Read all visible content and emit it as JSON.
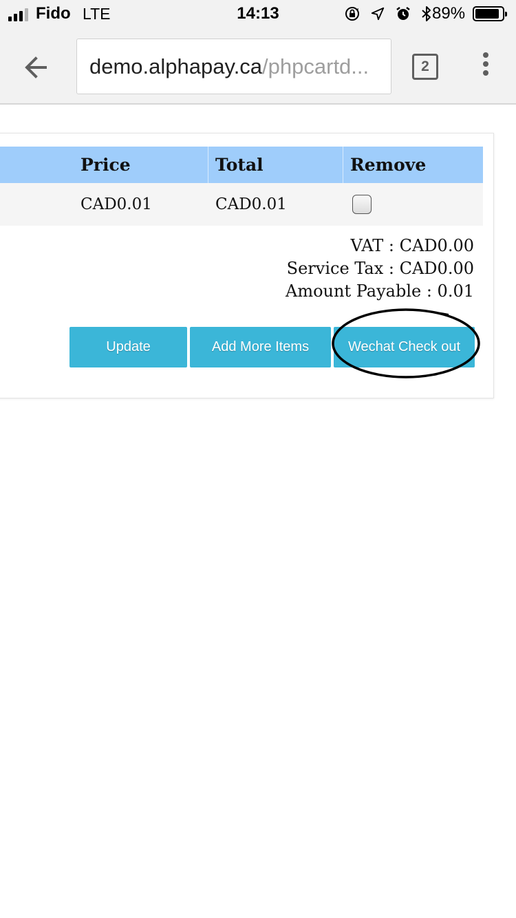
{
  "status_bar": {
    "carrier": "Fido",
    "network": "LTE",
    "time": "14:13",
    "battery_percent": "89%",
    "battery_level": 0.89,
    "signal_bars": 3,
    "icons": [
      "orientation-lock-icon",
      "location-icon",
      "alarm-icon",
      "bluetooth-icon"
    ]
  },
  "browser": {
    "url_host": "demo.alphapay.ca",
    "url_path": "/phpcartd...",
    "tab_count": "2",
    "icons": [
      "back-arrow-icon",
      "tabs-icon",
      "more-vert-icon"
    ]
  },
  "cart": {
    "columns": [
      "Price",
      "Total",
      "Remove"
    ],
    "rows": [
      {
        "price": "CAD0.01",
        "total": "CAD0.01",
        "remove_checked": false
      }
    ],
    "summary": {
      "vat": "VAT : CAD0.00",
      "service_tax": "Service Tax : CAD0.00",
      "amount_payable": "Amount Payable : 0.01"
    },
    "buttons": {
      "update": "Update",
      "add_more": "Add More Items",
      "wechat_checkout": "Wechat Check out"
    }
  },
  "colors": {
    "header_row": "#9fcdfb",
    "button": "#3bb6d8",
    "chrome": "#f2f2f2"
  }
}
